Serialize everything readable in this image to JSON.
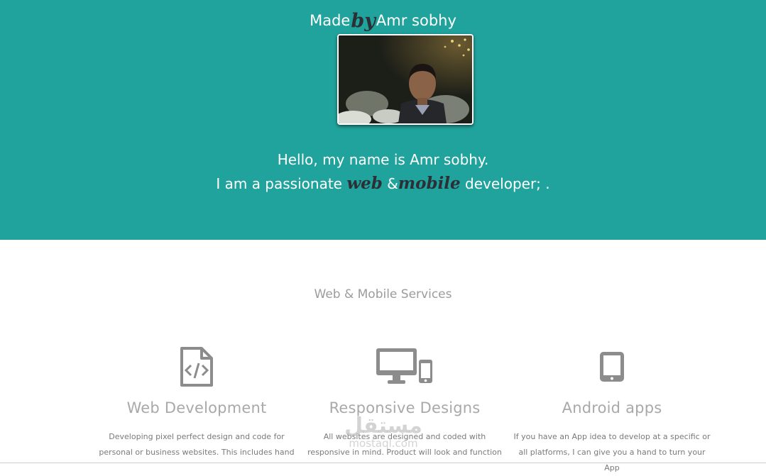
{
  "header": {
    "brand_prefix": "Made",
    "brand_script": "by",
    "brand_name": "Amr sobhy",
    "photo_alt": "Amr sobhy"
  },
  "intro": {
    "line1": "Hello, my name is Amr sobhy.",
    "line2_prefix": "I am a passionate ",
    "line2_web": "web",
    "line2_amp": " &",
    "line2_mobile": "mobile",
    "line2_suffix": " developer; ."
  },
  "services": {
    "title": "Web & Mobile Services",
    "items": [
      {
        "icon": "code-file-icon",
        "title": "Web Development",
        "desc_line1": "Developing pixel perfect design and code for",
        "desc_line2": "personal or business websites. This includes hand"
      },
      {
        "icon": "devices-icon",
        "title": "Responsive Designs",
        "desc_line1": "All websites are designed and coded with",
        "desc_line2": "responsive in mind. Product will look and function"
      },
      {
        "icon": "tablet-icon",
        "title": "Android apps",
        "desc_line1": "If you have an App idea to develop at a specific or",
        "desc_line2": "all platforms, I can give you a hand to turn your App"
      }
    ]
  },
  "watermark": {
    "arabic": "مستقل",
    "latin": "mostaql.com"
  },
  "colors": {
    "hero_bg": "#21a39d",
    "script_text": "#2b2f36",
    "icon_gray": "#8c8c8c"
  }
}
